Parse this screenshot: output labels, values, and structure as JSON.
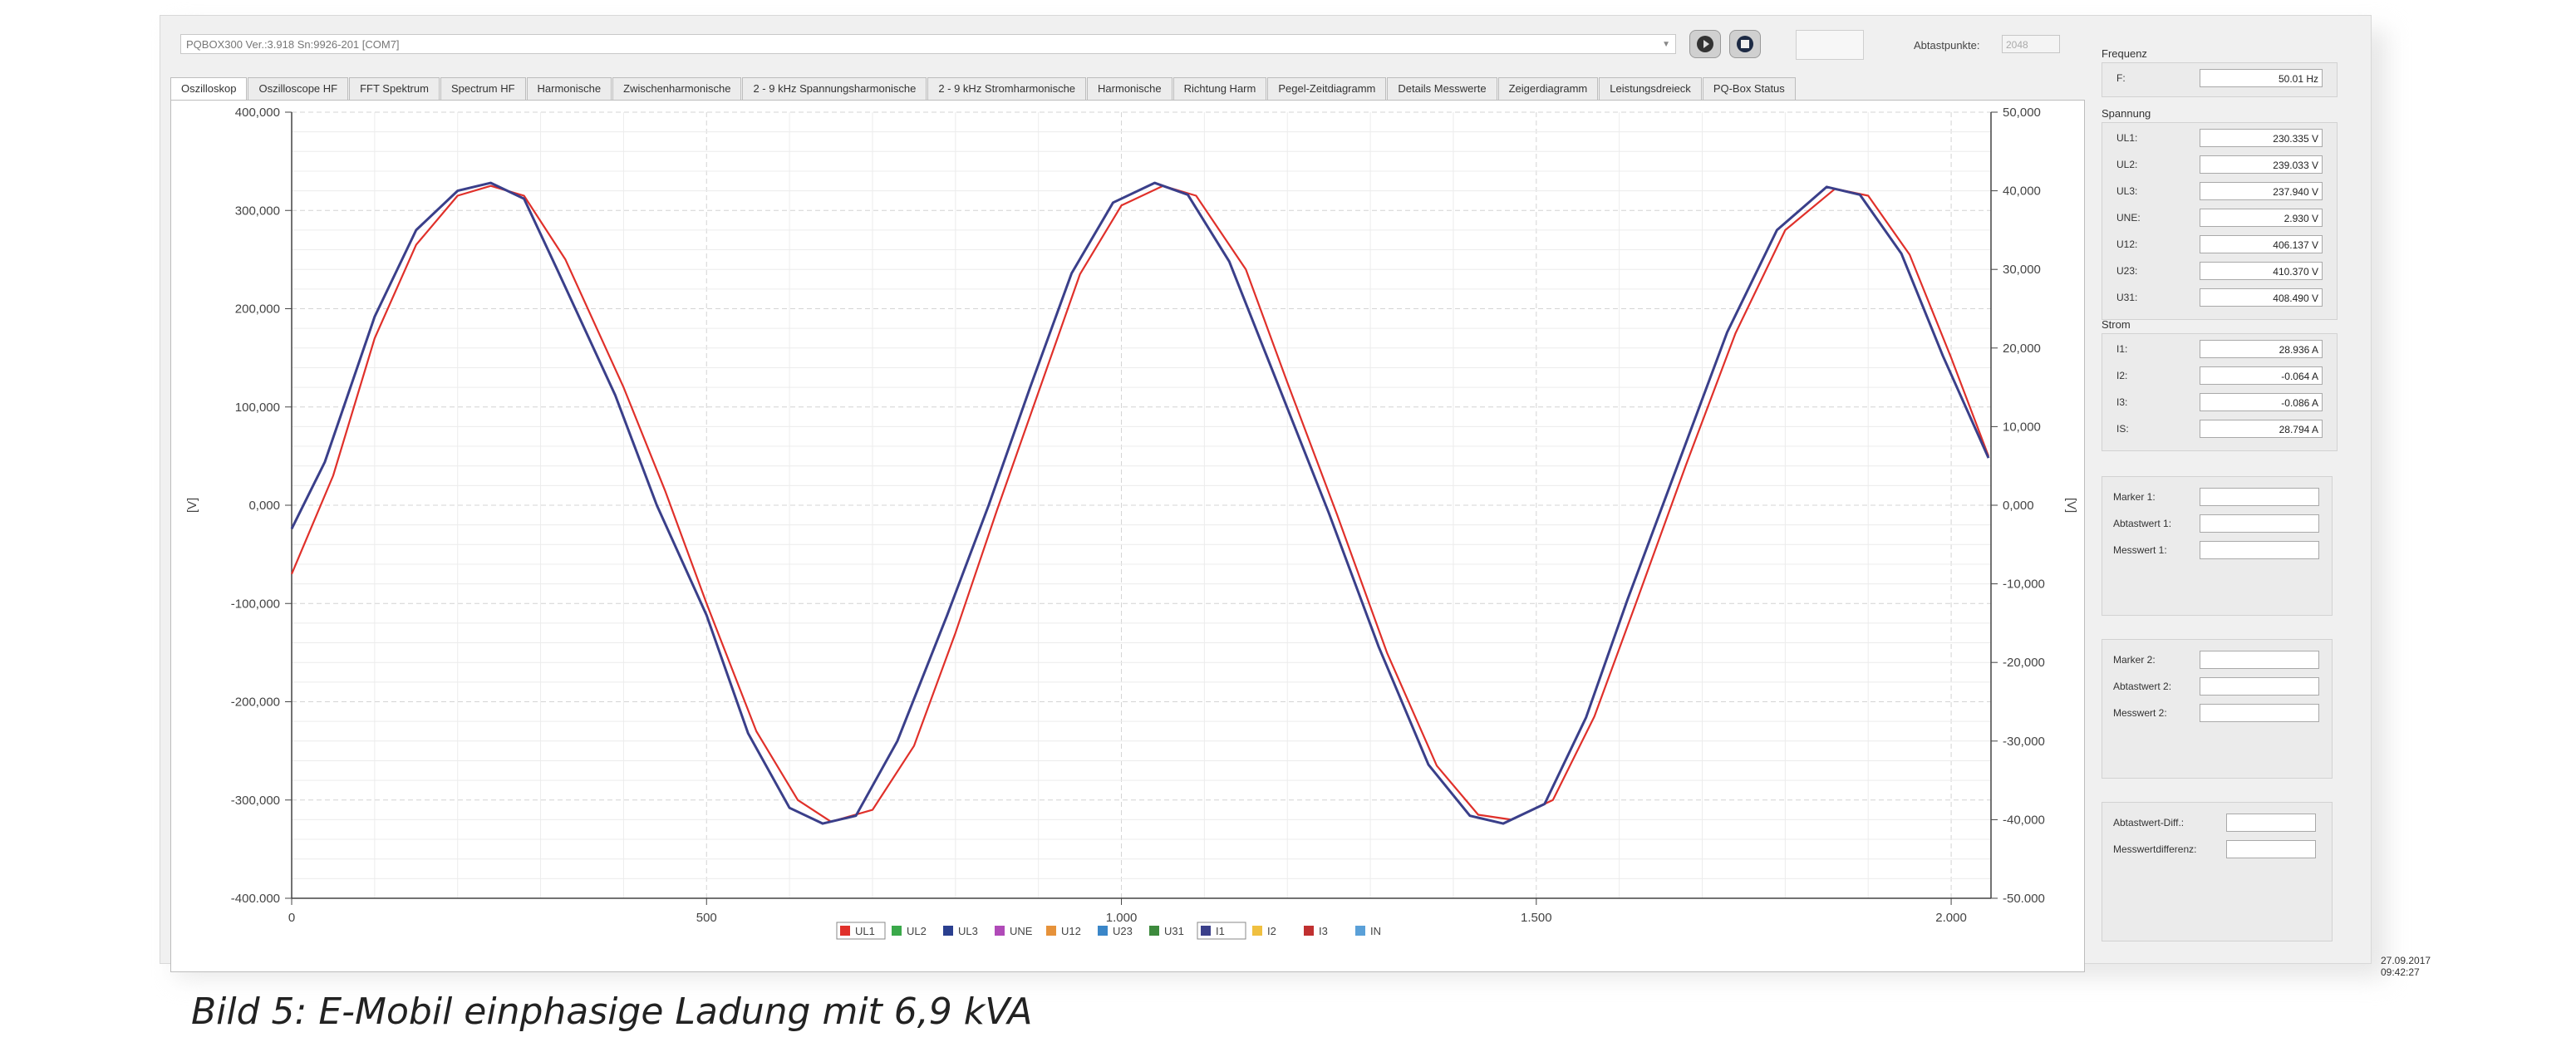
{
  "app": {
    "device": "PQBOX300 Ver.:3.918 Sn:9926-201 [COM7]",
    "sample_points_label": "Abtastpunkte:",
    "sample_points_value": "2048",
    "timestamp": "27.09.2017 09:42:27"
  },
  "tabs": [
    {
      "label": "Oszilloskop",
      "active": true
    },
    {
      "label": "Oszilloscope HF"
    },
    {
      "label": "FFT Spektrum"
    },
    {
      "label": "Spectrum HF"
    },
    {
      "label": "Harmonische"
    },
    {
      "label": "Zwischenharmonische"
    },
    {
      "label": "2 - 9 kHz Spannungsharmonische"
    },
    {
      "label": "2 - 9 kHz Stromharmonische"
    },
    {
      "label": "Harmonische"
    },
    {
      "label": "Richtung Harm"
    },
    {
      "label": "Pegel-Zeitdiagramm"
    },
    {
      "label": "Details Messwerte"
    },
    {
      "label": "Zeigerdiagramm"
    },
    {
      "label": "Leistungsdreieck"
    },
    {
      "label": "PQ-Box Status"
    }
  ],
  "side": {
    "frequency": {
      "title": "Frequenz",
      "rows": [
        {
          "label": "F:",
          "value": "50.01 Hz"
        }
      ]
    },
    "voltage": {
      "title": "Spannung",
      "rows": [
        {
          "label": "UL1:",
          "value": "230.335 V"
        },
        {
          "label": "UL2:",
          "value": "239.033 V"
        },
        {
          "label": "UL3:",
          "value": "237.940 V"
        },
        {
          "label": "UNE:",
          "value": "2.930 V"
        },
        {
          "label": "U12:",
          "value": "406.137 V"
        },
        {
          "label": "U23:",
          "value": "410.370 V"
        },
        {
          "label": "U31:",
          "value": "408.490 V"
        }
      ]
    },
    "current": {
      "title": "Strom",
      "rows": [
        {
          "label": "I1:",
          "value": "28.936 A"
        },
        {
          "label": "I2:",
          "value": "-0.064 A"
        },
        {
          "label": "I3:",
          "value": "-0.086 A"
        },
        {
          "label": "IS:",
          "value": "28.794 A"
        }
      ]
    },
    "marker1": [
      "Marker 1:",
      "Abtastwert 1:",
      "Messwert 1:"
    ],
    "marker2": [
      "Marker 2:",
      "Abtastwert 2:",
      "Messwert 2:"
    ],
    "diff": [
      "Abtastwert-Diff.:",
      "Messwertdifferenz:"
    ]
  },
  "chart_data": {
    "type": "line",
    "left_axis_label": "[V]",
    "right_axis_label": "[V]",
    "xlim": [
      0,
      2048
    ],
    "ylim_left": [
      -400000,
      400000
    ],
    "ylim_right": [
      -50000,
      50000
    ],
    "x_ticks": [
      "0",
      "500",
      "1.000",
      "1.500",
      "2.000"
    ],
    "x_tick_values": [
      0,
      500,
      1000,
      1500,
      2000
    ],
    "y_ticks_left": [
      "400,000",
      "300,000",
      "200,000",
      "100,000",
      "0,000",
      "-100,000",
      "-200,000",
      "-300,000",
      "-400.000"
    ],
    "y_ticks_right": [
      "50,000",
      "40,000",
      "30,000",
      "20,000",
      "10,000",
      "0,000",
      "-10,000",
      "-20,000",
      "-30,000",
      "-40,000",
      "-50.000"
    ],
    "legend": [
      {
        "name": "UL1",
        "color": "#e0302a"
      },
      {
        "name": "UL2",
        "color": "#3aa94a"
      },
      {
        "name": "UL3",
        "color": "#2a3f8f"
      },
      {
        "name": "UNE",
        "color": "#b04ab8"
      },
      {
        "name": "U12",
        "color": "#e6923a"
      },
      {
        "name": "U23",
        "color": "#3a86c8"
      },
      {
        "name": "U31",
        "color": "#3d8a3d"
      },
      {
        "name": "I1",
        "color": "#3a3f8a"
      },
      {
        "name": "I2",
        "color": "#f0c040"
      },
      {
        "name": "I3",
        "color": "#c03030"
      },
      {
        "name": "IN",
        "color": "#5aa0d8"
      }
    ],
    "series": [
      {
        "name": "UL1",
        "axis": "left",
        "color": "#e0302a",
        "points": [
          [
            0,
            -70000
          ],
          [
            50,
            30000
          ],
          [
            100,
            170000
          ],
          [
            150,
            265000
          ],
          [
            200,
            315000
          ],
          [
            240,
            325000
          ],
          [
            280,
            315000
          ],
          [
            330,
            250000
          ],
          [
            400,
            120000
          ],
          [
            450,
            15000
          ],
          [
            500,
            -100000
          ],
          [
            560,
            -230000
          ],
          [
            610,
            -300000
          ],
          [
            650,
            -322000
          ],
          [
            700,
            -310000
          ],
          [
            750,
            -245000
          ],
          [
            800,
            -130000
          ],
          [
            850,
            -5000
          ],
          [
            900,
            115000
          ],
          [
            950,
            235000
          ],
          [
            1000,
            305000
          ],
          [
            1050,
            325000
          ],
          [
            1090,
            315000
          ],
          [
            1150,
            240000
          ],
          [
            1200,
            125000
          ],
          [
            1260,
            -10000
          ],
          [
            1320,
            -150000
          ],
          [
            1380,
            -265000
          ],
          [
            1430,
            -315000
          ],
          [
            1470,
            -320000
          ],
          [
            1520,
            -300000
          ],
          [
            1570,
            -215000
          ],
          [
            1620,
            -100000
          ],
          [
            1680,
            40000
          ],
          [
            1740,
            175000
          ],
          [
            1800,
            280000
          ],
          [
            1860,
            322000
          ],
          [
            1900,
            315000
          ],
          [
            1950,
            255000
          ],
          [
            2000,
            150000
          ],
          [
            2045,
            50000
          ]
        ]
      },
      {
        "name": "I1",
        "axis": "right",
        "color": "#3a3f8a",
        "points": [
          [
            0,
            -3000
          ],
          [
            40,
            5500
          ],
          [
            100,
            24000
          ],
          [
            150,
            35000
          ],
          [
            200,
            40000
          ],
          [
            240,
            41000
          ],
          [
            280,
            39000
          ],
          [
            320,
            30000
          ],
          [
            390,
            14000
          ],
          [
            440,
            0
          ],
          [
            500,
            -14000
          ],
          [
            550,
            -29000
          ],
          [
            600,
            -38500
          ],
          [
            640,
            -40500
          ],
          [
            680,
            -39500
          ],
          [
            730,
            -30000
          ],
          [
            790,
            -14000
          ],
          [
            840,
            0
          ],
          [
            890,
            15000
          ],
          [
            940,
            29500
          ],
          [
            990,
            38500
          ],
          [
            1040,
            41000
          ],
          [
            1080,
            39500
          ],
          [
            1130,
            31000
          ],
          [
            1190,
            15000
          ],
          [
            1250,
            -1000
          ],
          [
            1310,
            -18000
          ],
          [
            1370,
            -33000
          ],
          [
            1420,
            -39500
          ],
          [
            1460,
            -40500
          ],
          [
            1510,
            -38000
          ],
          [
            1560,
            -27000
          ],
          [
            1610,
            -12000
          ],
          [
            1670,
            5000
          ],
          [
            1730,
            22000
          ],
          [
            1790,
            35000
          ],
          [
            1850,
            40500
          ],
          [
            1890,
            39500
          ],
          [
            1940,
            32000
          ],
          [
            1990,
            19000
          ],
          [
            2045,
            6000
          ]
        ]
      }
    ]
  },
  "caption": "Bild 5: E-Mobil einphasige Ladung mit 6,9 kVA"
}
